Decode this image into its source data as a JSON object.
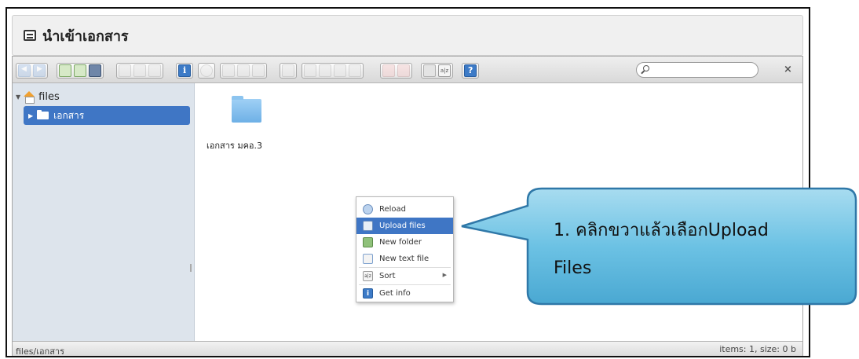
{
  "panel": {
    "title": "นำเข้าเอกสาร"
  },
  "toolbar": {
    "groups": [
      [
        "back-icon",
        "forward-icon"
      ],
      [
        "home-icon",
        "up-icon",
        "reload-icon"
      ],
      [
        "open-icon",
        "mkdir-icon",
        "mkfile-icon"
      ],
      [
        "info-icon"
      ],
      [
        "quicklook-icon",
        "copy-icon",
        "cut-icon",
        "paste-icon"
      ],
      [
        "duplicate-icon"
      ],
      [
        "rename-icon",
        "edit-icon",
        "resize-icon",
        "archive-icon",
        "extract-icon"
      ],
      [
        "view-icon",
        "sort-icon"
      ],
      [
        "help-icon"
      ]
    ],
    "search_placeholder": ""
  },
  "tree": {
    "root": "files",
    "items": [
      {
        "label": "เอกสาร"
      }
    ]
  },
  "content": {
    "files": [
      {
        "name": "เอกสาร มคอ.3"
      }
    ]
  },
  "context_menu": {
    "items": [
      {
        "label": "Reload",
        "icon": "reload-icon"
      },
      {
        "label": "Upload files",
        "icon": "upload-icon"
      },
      {
        "label": "New folder",
        "icon": "new-folder-icon"
      },
      {
        "label": "New text file",
        "icon": "new-text-file-icon"
      },
      {
        "label": "Sort",
        "icon": "sort-icon"
      },
      {
        "label": "Get info",
        "icon": "info-icon"
      }
    ],
    "active": "Upload files"
  },
  "status": {
    "path": "files/เอกสาร",
    "info": "items: 1, size: 0 b"
  },
  "callout": {
    "line1": "1. คลิกขวาแล้วเลือกUpload",
    "line2": "Files",
    "fill": "#6cc2e4",
    "stroke": "#2f78a8"
  }
}
